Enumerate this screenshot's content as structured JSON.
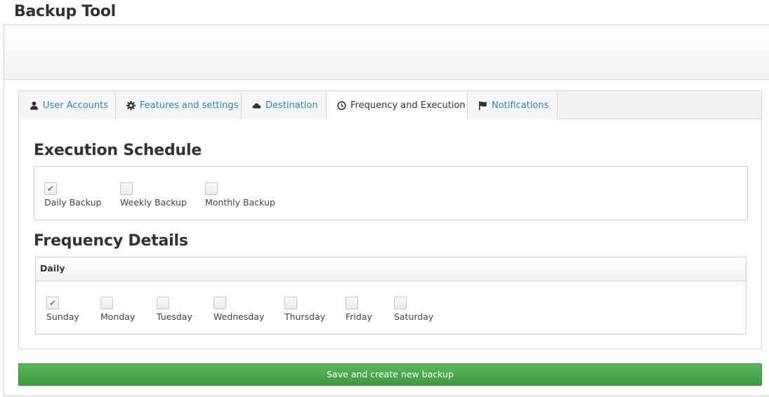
{
  "page": {
    "title": "Backup Tool"
  },
  "tabs": [
    {
      "label": "User Accounts",
      "icon": "user-icon",
      "active": false
    },
    {
      "label": "Features and settings",
      "icon": "gear-icon",
      "active": false
    },
    {
      "label": "Destination",
      "icon": "cloud-icon",
      "active": false
    },
    {
      "label": "Frequency and Execution",
      "icon": "clock-icon",
      "active": true
    },
    {
      "label": "Notifications",
      "icon": "flag-icon",
      "active": false
    }
  ],
  "execution_schedule": {
    "heading": "Execution Schedule",
    "options": [
      {
        "label": "Daily Backup",
        "checked": true
      },
      {
        "label": "Weekly Backup",
        "checked": false
      },
      {
        "label": "Monthly Backup",
        "checked": false
      }
    ]
  },
  "frequency_details": {
    "heading": "Frequency Details",
    "daily": {
      "title": "Daily",
      "days": [
        {
          "label": "Sunday",
          "checked": true
        },
        {
          "label": "Monday",
          "checked": false
        },
        {
          "label": "Tuesday",
          "checked": false
        },
        {
          "label": "Wednesday",
          "checked": false
        },
        {
          "label": "Thursday",
          "checked": false
        },
        {
          "label": "Friday",
          "checked": false
        },
        {
          "label": "Saturday",
          "checked": false
        }
      ]
    }
  },
  "actions": {
    "save_label": "Save and create new backup"
  },
  "colors": {
    "link": "#2f86b5",
    "save_button": "#4cae4c",
    "text": "#333333"
  },
  "check_mark": "✔"
}
